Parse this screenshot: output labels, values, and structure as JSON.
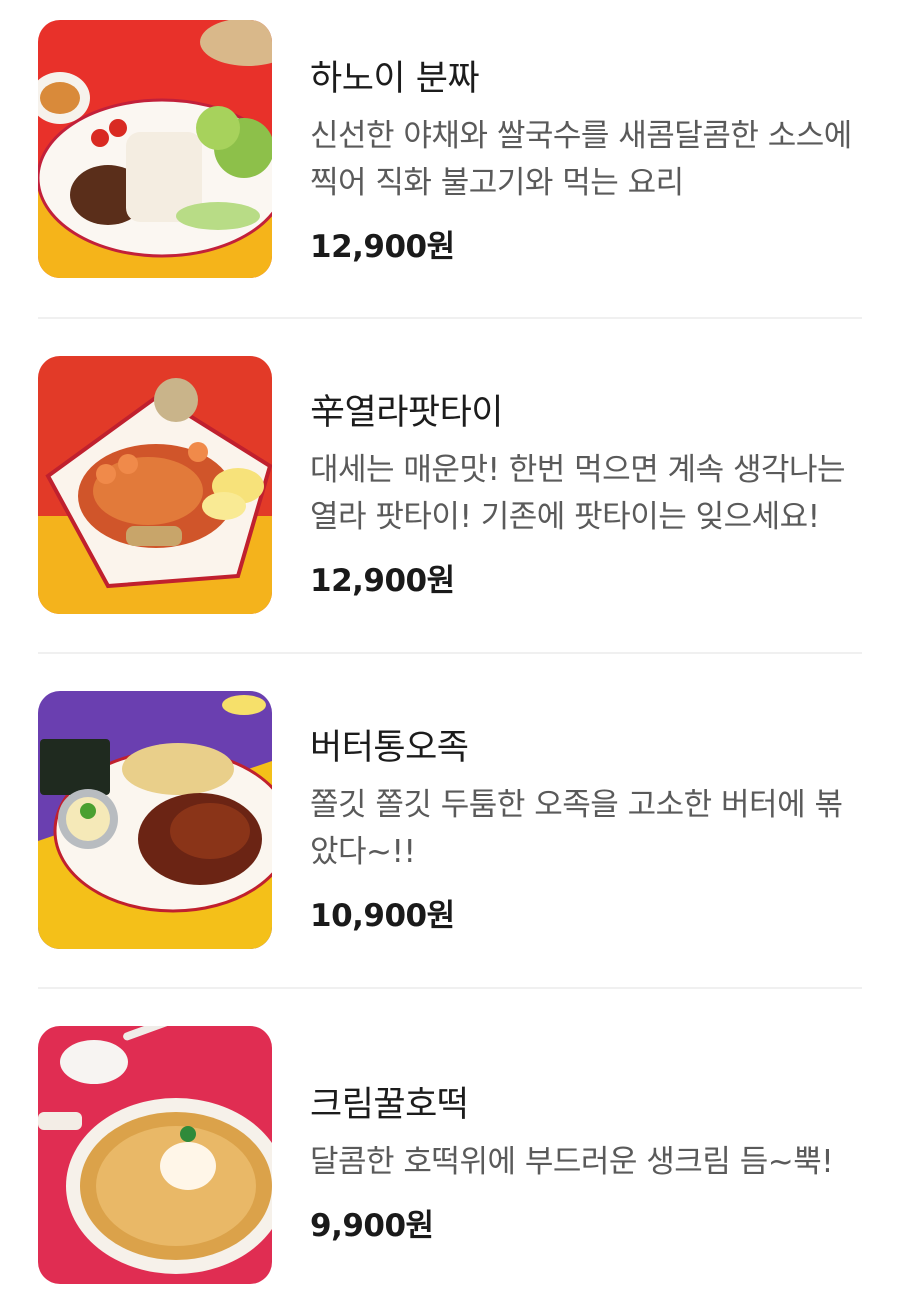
{
  "menu": {
    "items": [
      {
        "name": "하노이 분짜",
        "description": "신선한 야채와 쌀국수를 새콤달콤한 소스에 찍어 직화 불고기와 먹는 요리",
        "price": "12,900원",
        "image_bg": "#e8312a",
        "image_bg2": "#f5b41a"
      },
      {
        "name": "辛열라팟타이",
        "description": "대세는 매운맛! 한번 먹으면 계속 생각나는 열라 팟타이! 기존에 팟타이는 잊으세요!",
        "price": "12,900원",
        "image_bg": "#e23a28",
        "image_bg2": "#f4b31c"
      },
      {
        "name": "버터통오족",
        "description": "쫄깃 쫄깃 두툼한 오족을 고소한 버터에 볶았다~!!",
        "price": "10,900원",
        "image_bg": "#6a3fb0",
        "image_bg2": "#f4c019"
      },
      {
        "name": "크림꿀호떡",
        "description": "달콤한 호떡위에 부드러운 생크림 듬~뿍!",
        "price": "9,900원",
        "image_bg": "#e02d52",
        "image_bg2": "#e02d52"
      }
    ]
  }
}
